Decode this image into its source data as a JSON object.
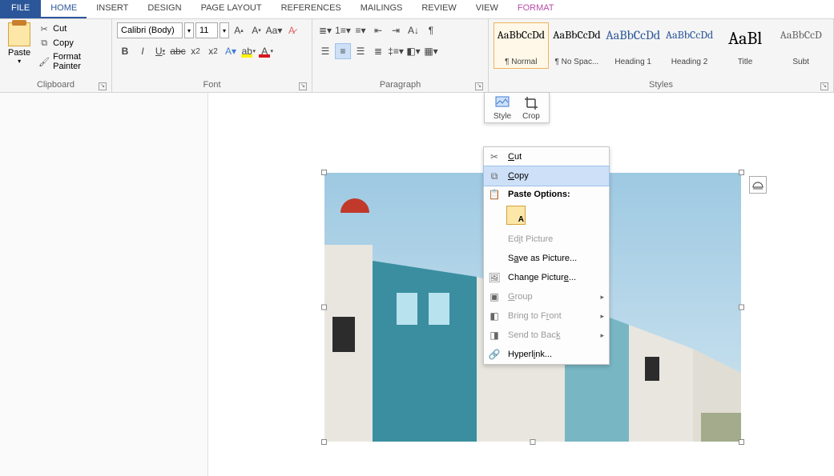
{
  "tabs": {
    "file": "FILE",
    "home": "HOME",
    "insert": "INSERT",
    "design": "DESIGN",
    "page_layout": "PAGE LAYOUT",
    "references": "REFERENCES",
    "mailings": "MAILINGS",
    "review": "REVIEW",
    "view": "VIEW",
    "format": "FORMAT"
  },
  "clipboard": {
    "paste": "Paste",
    "cut": "Cut",
    "copy": "Copy",
    "format_painter": "Format Painter",
    "group_label": "Clipboard"
  },
  "font": {
    "name": "Calibri (Body)",
    "size": "11",
    "group_label": "Font"
  },
  "paragraph": {
    "group_label": "Paragraph"
  },
  "styles": {
    "group_label": "Styles",
    "items": [
      {
        "preview": "AaBbCcDd",
        "name": "¶ Normal"
      },
      {
        "preview": "AaBbCcDd",
        "name": "¶ No Spac..."
      },
      {
        "preview": "AaBbCcDd",
        "name": "Heading 1"
      },
      {
        "preview": "AaBbCcDd",
        "name": "Heading 2"
      },
      {
        "preview": "AaBl",
        "name": "Title"
      },
      {
        "preview": "AaBbCcD",
        "name": "Subt"
      }
    ]
  },
  "mini_toolbar": {
    "style": "Style",
    "crop": "Crop"
  },
  "context_menu": {
    "cut": "Cut",
    "copy": "Copy",
    "paste_options": "Paste Options:",
    "edit_picture": "Edit Picture",
    "save_as_picture": "Save as Picture...",
    "change_picture": "Change Picture...",
    "group": "Group",
    "bring_to_front": "Bring to Front",
    "send_to_back": "Send to Back",
    "hyperlink": "Hyperlink..."
  }
}
